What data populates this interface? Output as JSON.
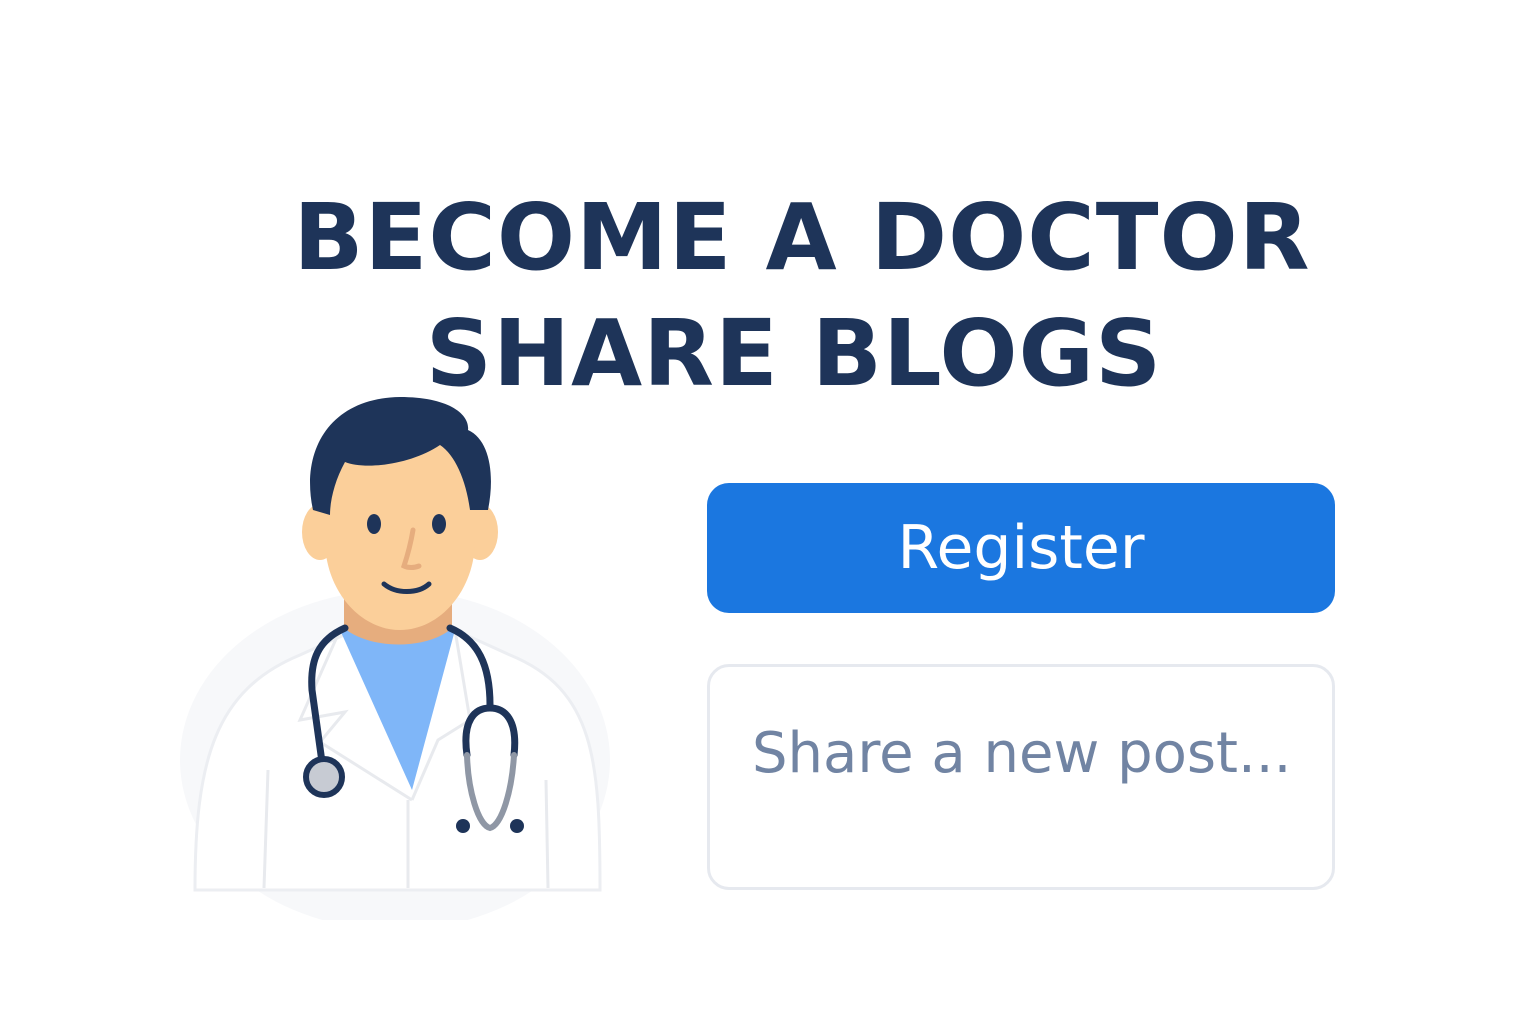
{
  "headline": {
    "line1": "BECOME A DOCTOR",
    "line2": "SHARE BLOGS"
  },
  "register": {
    "label": "Register"
  },
  "post": {
    "placeholder": "Share a new post..."
  },
  "icons": {
    "illustration": "doctor-with-stethoscope-illustration"
  },
  "colors": {
    "headline": "#1e3459",
    "register_button": "#1b77e0",
    "register_text": "#ffffff",
    "placeholder": "#7184a3",
    "post_border": "#e6e9ef",
    "doctor_hair": "#1e3459",
    "doctor_skin": "#fbcf9a",
    "doctor_scrubs": "#7fb6f8",
    "doctor_coat": "#ffffff"
  }
}
